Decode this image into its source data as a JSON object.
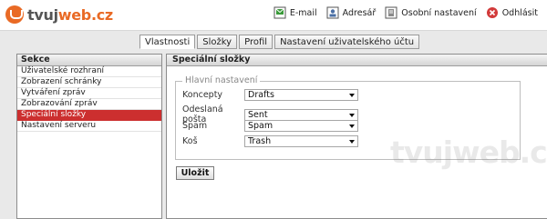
{
  "logo": {
    "part1": "tvuj",
    "part2": "web.cz"
  },
  "toolbar": {
    "links": [
      {
        "label": "E-mail",
        "icon": "email-icon"
      },
      {
        "label": "Adresář",
        "icon": "address-book-icon"
      },
      {
        "label": "Osobní nastavení",
        "icon": "personal-settings-icon"
      },
      {
        "label": "Odhlásit",
        "icon": "logout-icon"
      }
    ]
  },
  "tabs": [
    {
      "label": "Vlastnosti",
      "active": true
    },
    {
      "label": "Složky",
      "active": false
    },
    {
      "label": "Profil",
      "active": false
    },
    {
      "label": "Nastavení uživatelského účtu",
      "active": false
    }
  ],
  "sections": {
    "title": "Sekce",
    "items": [
      {
        "label": "Uživatelské rozhraní"
      },
      {
        "label": "Zobrazení schránky"
      },
      {
        "label": "Vytváření zpráv"
      },
      {
        "label": "Zobrazování zpráv"
      },
      {
        "label": "Speciální složky",
        "active": true
      },
      {
        "label": "Nastavení serveru"
      }
    ]
  },
  "content": {
    "title": "Speciální složky",
    "fieldset_legend": "Hlavní nastavení",
    "fields": [
      {
        "label": "Koncepty",
        "value": "Drafts"
      },
      {
        "label": "Odeslaná pošta",
        "value": "Sent"
      },
      {
        "label": "Spam",
        "value": "Spam"
      },
      {
        "label": "Koš",
        "value": "Trash"
      }
    ],
    "save_label": "Uložit"
  },
  "watermark": "tvujweb.cz",
  "colors": {
    "brand_orange": "#e96a25",
    "active_red": "#cc2f2f"
  }
}
